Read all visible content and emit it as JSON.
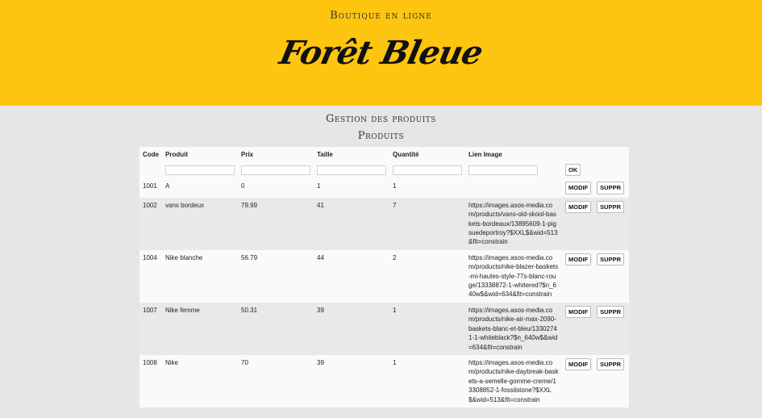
{
  "header": {
    "subtitle": "Boutique en ligne",
    "brand": "Forêt Bleue"
  },
  "page": {
    "title": "Gestion des produits",
    "section": "Produits"
  },
  "table": {
    "columns": [
      "Code",
      "Produit",
      "Prix",
      "Taille",
      "Quantité",
      "Lien Image"
    ],
    "ok_label": "OK",
    "modif_label": "MODIF",
    "suppr_label": "SUPPR",
    "rows": [
      {
        "code": "1001",
        "produit": "A",
        "prix": "0",
        "taille": "1",
        "quantite": "1",
        "lien": ""
      },
      {
        "code": "1002",
        "produit": "vans bordeux",
        "prix": "79.99",
        "taille": "41",
        "quantite": "7",
        "lien": "https://images.asos-media.com/products/vans-old-skool-baskets-bordeaux/13895609-1-pigsuedeportroy?$XXL$&wid=513&fit=constrain"
      },
      {
        "code": "1004",
        "produit": "Nike blanche",
        "prix": "56.79",
        "taille": "44",
        "quantite": "2",
        "lien": "https://images.asos-media.com/products/nike-blazer-baskets-mi-hautes-style-77s-blanc-rouge/13338872-1-whitered?$n_640w$&wid=634&fit=constrain"
      },
      {
        "code": "1007",
        "produit": "Nike femme",
        "prix": "50.31",
        "taille": "39",
        "quantite": "1",
        "lien": "https://images.asos-media.com/products/nike-air-max-2090-baskets-blanc-et-bleu/13302741-1-whiteblack?$n_640w$&wid=634&fit=constrain"
      },
      {
        "code": "1008",
        "produit": "Nike",
        "prix": "70",
        "taille": "39",
        "quantite": "1",
        "lien": "https://images.asos-media.com/products/nike-daybreak-baskets-a-semelle-gomme-creme/13308852-1-fossilstone?$XXL$&wid=513&fit=constrain"
      }
    ]
  }
}
